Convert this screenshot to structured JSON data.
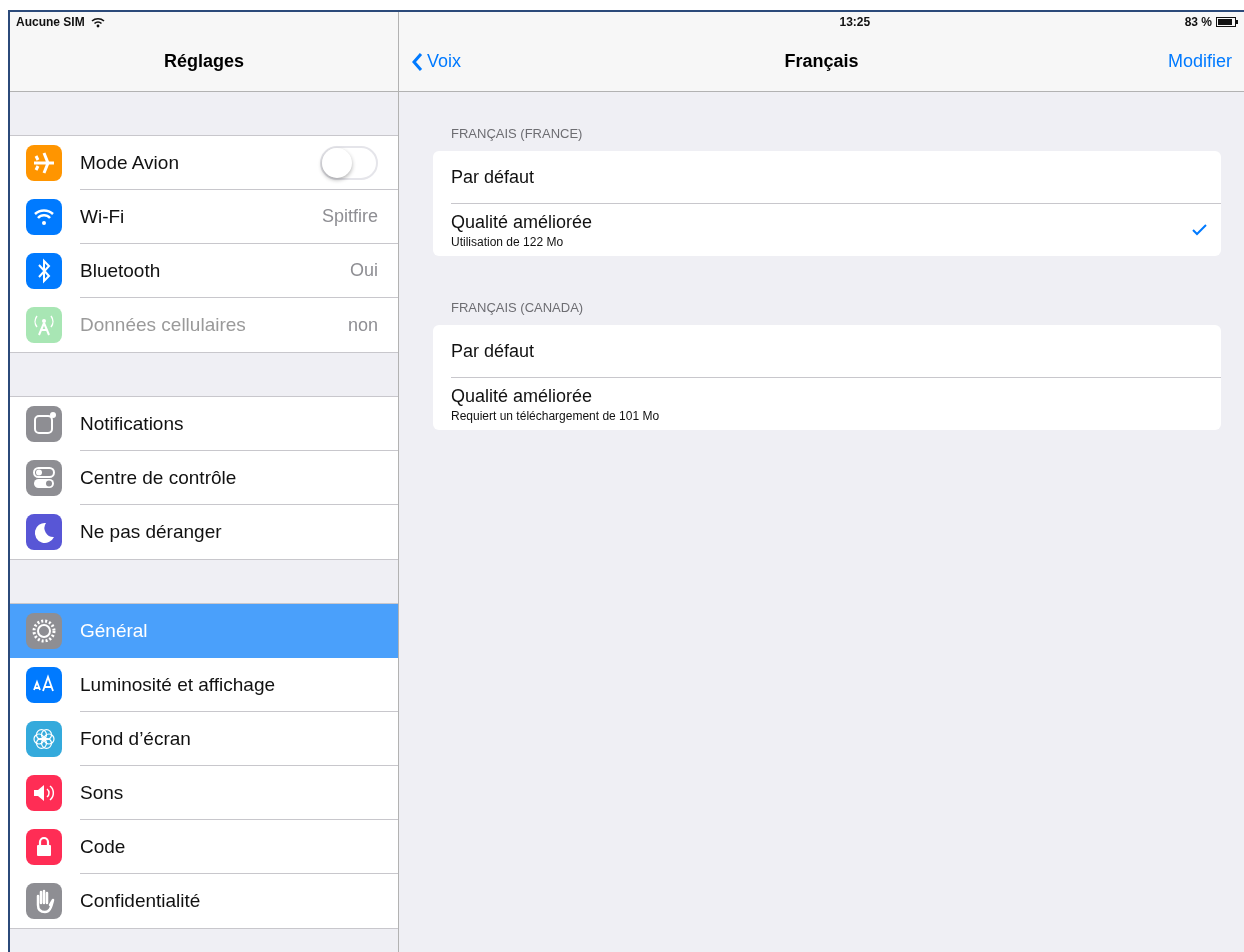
{
  "status_bar": {
    "carrier": "Aucune SIM",
    "time": "13:25",
    "battery": "83 %"
  },
  "sidebar": {
    "title": "Réglages",
    "groups": [
      [
        {
          "label": "Mode Avion",
          "kind": "toggle",
          "on": false,
          "color": "#ff9500",
          "disabled": false,
          "selected": false
        },
        {
          "label": "Wi-Fi",
          "kind": "value",
          "value": "Spitfire",
          "color": "#007aff",
          "disabled": false,
          "selected": false
        },
        {
          "label": "Bluetooth",
          "kind": "value",
          "value": "Oui",
          "color": "#007aff",
          "disabled": false,
          "selected": false
        },
        {
          "label": "Données cellulaires",
          "kind": "value",
          "value": "non",
          "color": "#a8e6b4",
          "disabled": true,
          "selected": false
        }
      ],
      [
        {
          "label": "Notifications",
          "kind": "plain",
          "color": "#8e8e93",
          "disabled": false,
          "selected": false
        },
        {
          "label": "Centre de contrôle",
          "kind": "plain",
          "color": "#8e8e93",
          "disabled": false,
          "selected": false
        },
        {
          "label": "Ne pas déranger",
          "kind": "plain",
          "color": "#5856d6",
          "disabled": false,
          "selected": false
        }
      ],
      [
        {
          "label": "Général",
          "kind": "plain",
          "color": "#8e8e93",
          "disabled": false,
          "selected": true
        },
        {
          "label": "Luminosité et affichage",
          "kind": "plain",
          "color": "#007aff",
          "disabled": false,
          "selected": false
        },
        {
          "label": "Fond d’écran",
          "kind": "plain",
          "color": "#34aadc",
          "disabled": false,
          "selected": false
        },
        {
          "label": "Sons",
          "kind": "plain",
          "color": "#ff2d55",
          "disabled": false,
          "selected": false
        },
        {
          "label": "Code",
          "kind": "plain",
          "color": "#ff2d55",
          "disabled": false,
          "selected": false
        },
        {
          "label": "Confidentialité",
          "kind": "plain",
          "color": "#8e8e93",
          "disabled": false,
          "selected": false
        }
      ]
    ]
  },
  "detail": {
    "back": "Voix",
    "title": "Français",
    "action": "Modifier",
    "sections": [
      {
        "header": "FRANÇAIS (FRANCE)",
        "items": [
          {
            "label": "Par défaut",
            "selected": false
          },
          {
            "label": "Qualité améliorée",
            "subtitle": "Utilisation de 122 Mo",
            "selected": true
          }
        ]
      },
      {
        "header": "FRANÇAIS (CANADA)",
        "items": [
          {
            "label": "Par défaut",
            "selected": false
          },
          {
            "label": "Qualité améliorée",
            "subtitle": "Requiert un téléchargement de 101 Mo",
            "selected": false
          }
        ]
      }
    ]
  }
}
